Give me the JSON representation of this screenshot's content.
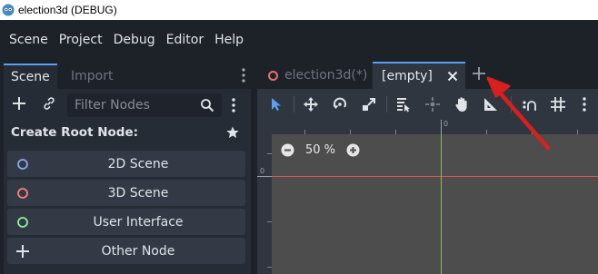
{
  "window": {
    "title": "election3d (DEBUG)"
  },
  "menu": {
    "items": [
      {
        "label": "Scene"
      },
      {
        "label": "Project"
      },
      {
        "label": "Debug"
      },
      {
        "label": "Editor"
      },
      {
        "label": "Help"
      }
    ]
  },
  "dock": {
    "tabs": [
      {
        "label": "Scene",
        "active": true
      },
      {
        "label": "Import",
        "active": false
      }
    ],
    "filter_placeholder": "Filter Nodes",
    "create_root_title": "Create Root Node:",
    "root_buttons": [
      {
        "label": "2D Scene",
        "icon": "node2d-icon",
        "color": "#8da5f3"
      },
      {
        "label": "3D Scene",
        "icon": "node3d-icon",
        "color": "#fc7f7f"
      },
      {
        "label": "User Interface",
        "icon": "control-icon",
        "color": "#8eef97"
      },
      {
        "label": "Other Node",
        "icon": "add-icon",
        "color": "#e0e3e8"
      }
    ]
  },
  "scene_tabs": [
    {
      "label": "election3d(*)",
      "active": false,
      "icon": "node3d-icon"
    },
    {
      "label": "[empty]",
      "active": true
    }
  ],
  "viewport": {
    "zoom_label": "50 %",
    "ruler_top_origin": "0",
    "ruler_left_origin": "0"
  },
  "colors": {
    "accent": "#5a9ff5",
    "x_axis": "#d9545c",
    "y_axis": "#8bbd4f",
    "annotation_arrow": "#d9201d"
  }
}
